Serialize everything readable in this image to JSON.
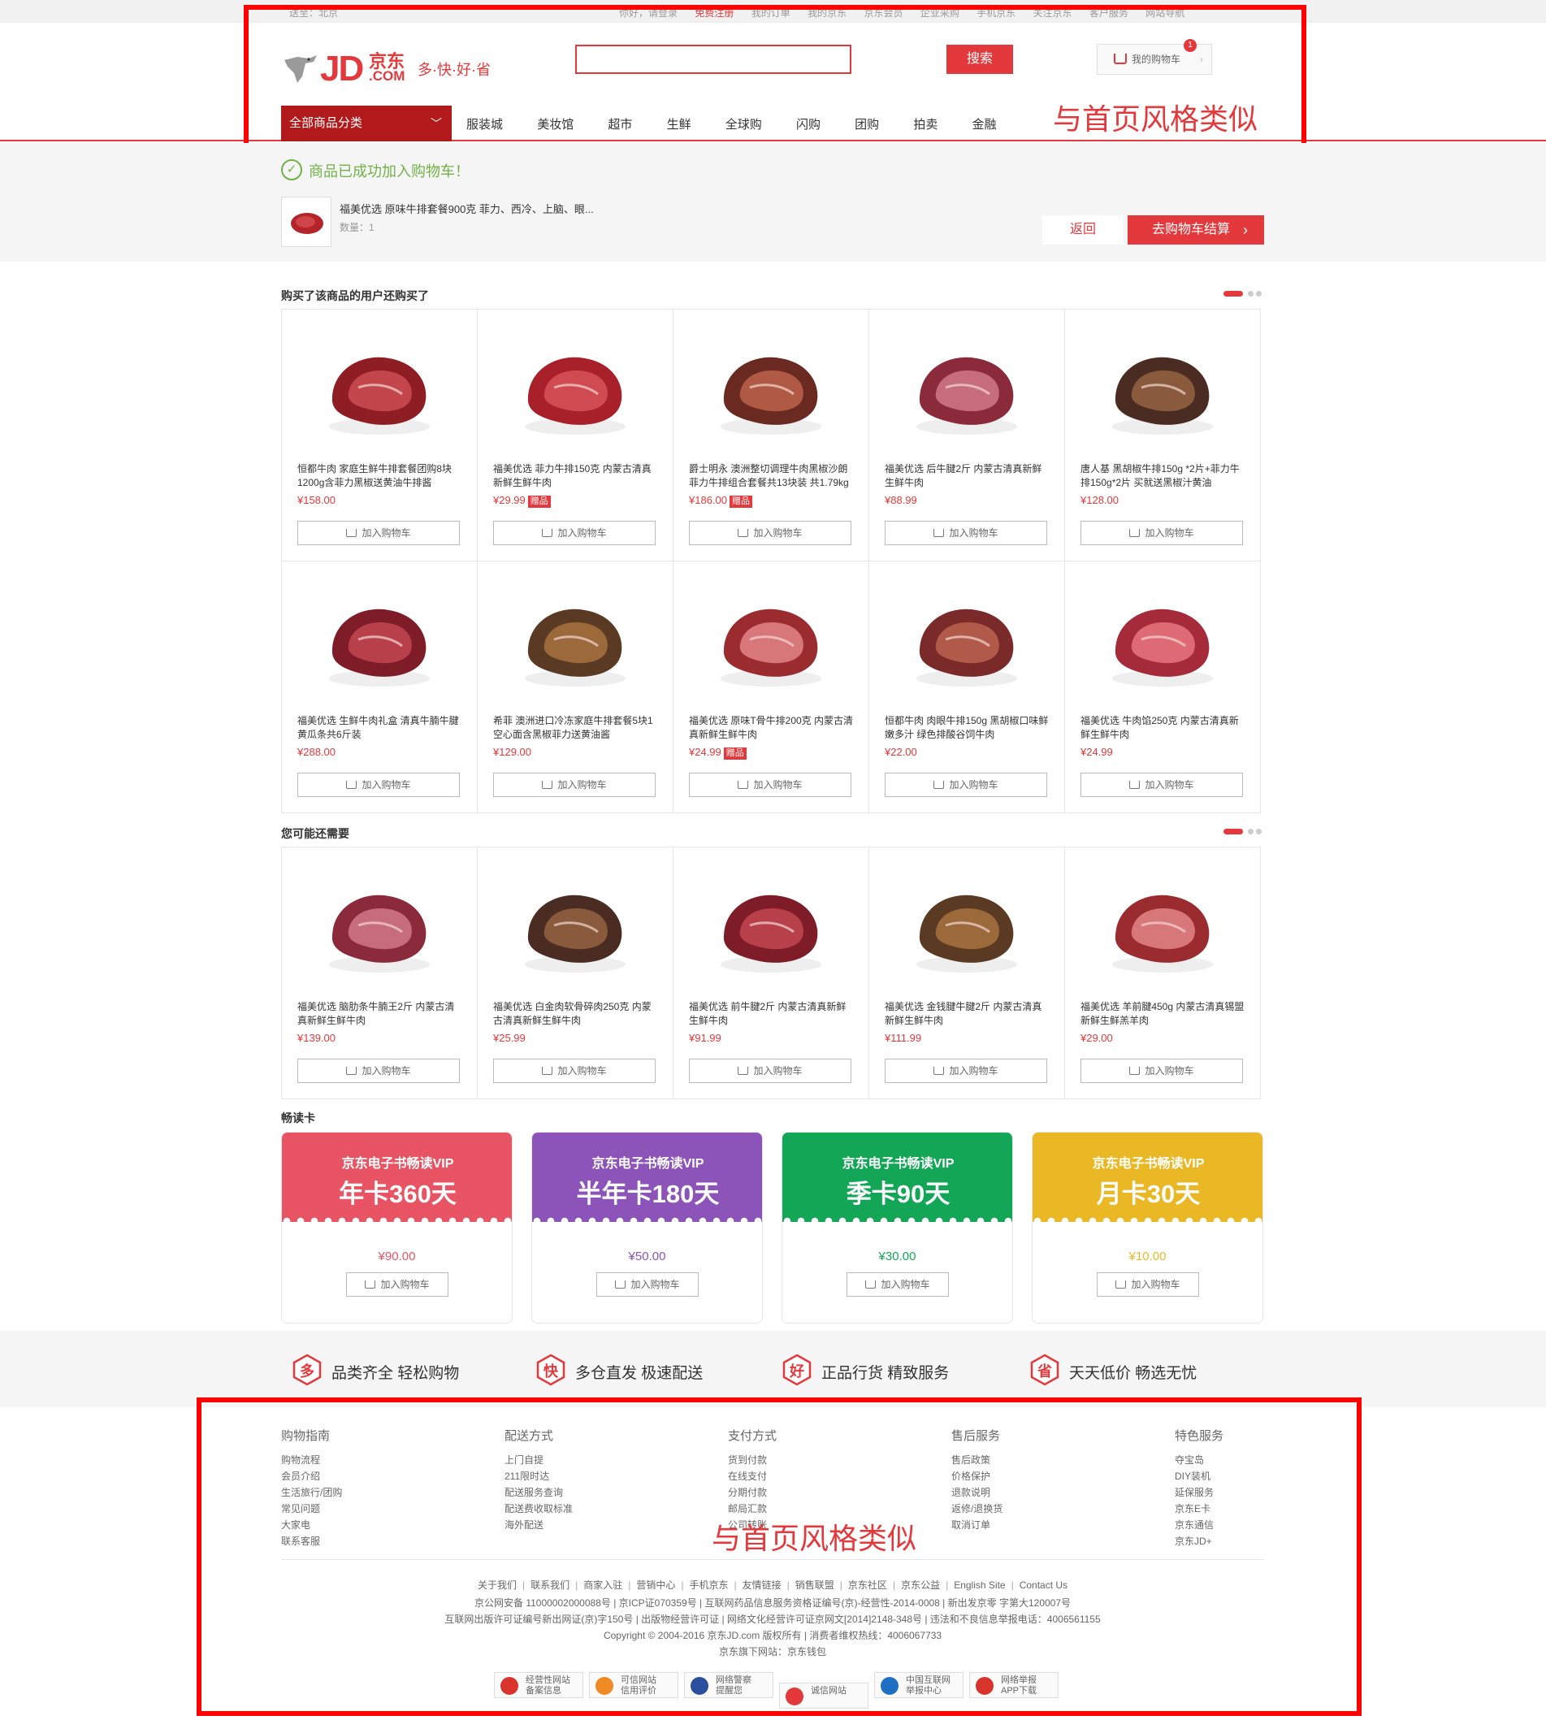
{
  "topbar": {
    "location_label": "送至：北京",
    "links": [
      "你好，请登录",
      "免费注册",
      "我的订单",
      "我的京东",
      "京东会员",
      "企业采购",
      "手机京东",
      "关注京东",
      "客户服务",
      "网站导航"
    ]
  },
  "header": {
    "logo_text": "JD",
    "logo_cn": "京东",
    "logo_com": ".COM",
    "slogan": "多·快·好·省",
    "search_placeholder": "",
    "search_button": "搜索",
    "cart_label": "我的购物车",
    "cart_count": "1",
    "nav_all": "全部商品分类",
    "nav_items": [
      "服装城",
      "美妆馆",
      "超市",
      "生鲜",
      "全球购",
      "闪购",
      "团购",
      "拍卖",
      "金融"
    ]
  },
  "annotations": {
    "header_note": "与首页风格类似",
    "footer_note": "与首页风格类似"
  },
  "success": {
    "message": "商品已成功加入购物车！",
    "product_name": "福美优选 原味牛排套餐900克 菲力、西冷、上脑、眼...",
    "quantity": "数量：1",
    "back_button": "返回",
    "checkout_button": "去购物车结算"
  },
  "sections": {
    "also_bought_title": "购买了该商品的用户还购买了",
    "maybe_need_title": "您可能还需要",
    "reading_title": "畅读卡",
    "add_to_cart": "加入购物车",
    "gift_label": "赠品"
  },
  "also_bought": [
    {
      "name": "恒都牛肉 家庭生鲜牛排套餐团购8块1200g含菲力黑椒送黄油牛排酱",
      "price": "¥158.00",
      "gift": false
    },
    {
      "name": "福美优选 菲力牛排150克 内蒙古清真新鲜生鲜牛肉",
      "price": "¥29.99",
      "gift": true
    },
    {
      "name": "爵士明永 澳洲整切调理牛肉黑椒沙朗菲力牛排组合套餐共13块装 共1.79kg",
      "price": "¥186.00",
      "gift": true
    },
    {
      "name": "福美优选 后牛腱2斤 内蒙古清真新鲜生鲜牛肉",
      "price": "¥88.99",
      "gift": false
    },
    {
      "name": "唐人基 黑胡椒牛排150g *2片+菲力牛排150g*2片 买就送黑椒汁黄油",
      "price": "¥128.00",
      "gift": false
    },
    {
      "name": "福美优选 生鲜牛肉礼盒 清真牛腩牛腱黄瓜条共6斤装",
      "price": "¥288.00",
      "gift": false
    },
    {
      "name": "希菲 澳洲进口冷冻家庭牛排套餐5块1空心面含黑椒菲力送黄油酱",
      "price": "¥129.00",
      "gift": false
    },
    {
      "name": "福美优选 原味T骨牛排200克 内蒙古清真新鲜生鲜牛肉",
      "price": "¥24.99",
      "gift": true
    },
    {
      "name": "恒都牛肉 肉眼牛排150g 黑胡椒口味鲜嫩多汁 绿色排酸谷饲牛肉",
      "price": "¥22.00",
      "gift": false
    },
    {
      "name": "福美优选 牛肉馅250克 内蒙古清真新鲜生鲜牛肉",
      "price": "¥24.99",
      "gift": false
    }
  ],
  "maybe_need": [
    {
      "name": "福美优选 脑肋条牛腩王2斤 内蒙古清真新鲜生鲜牛肉",
      "price": "¥139.00"
    },
    {
      "name": "福美优选 白金肉软骨碎肉250克 内蒙古清真新鲜生鲜牛肉",
      "price": "¥25.99"
    },
    {
      "name": "福美优选 前牛腱2斤 内蒙古清真新鲜生鲜牛肉",
      "price": "¥91.99"
    },
    {
      "name": "福美优选 金钱腱牛腱2斤 内蒙古清真新鲜生鲜牛肉",
      "price": "¥111.99"
    },
    {
      "name": "福美优选 羊前腱450g 内蒙古清真锡盟新鲜生鲜羔羊肉",
      "price": "¥29.00"
    }
  ],
  "reading_cards": [
    {
      "title": "京东电子书畅读VIP",
      "plan": "年卡360天",
      "price": "¥90.00",
      "color": "#e95464"
    },
    {
      "title": "京东电子书畅读VIP",
      "plan": "半年卡180天",
      "price": "¥50.00",
      "color": "#8c53b9"
    },
    {
      "title": "京东电子书畅读VIP",
      "plan": "季卡90天",
      "price": "¥30.00",
      "color": "#13a657"
    },
    {
      "title": "京东电子书畅读VIP",
      "plan": "月卡30天",
      "price": "¥10.00",
      "color": "#eab824"
    }
  ],
  "service": [
    {
      "glyph": "多",
      "text": "品类齐全  轻松购物"
    },
    {
      "glyph": "快",
      "text": "多仓直发  极速配送"
    },
    {
      "glyph": "好",
      "text": "正品行货  精致服务"
    },
    {
      "glyph": "省",
      "text": "天天低价  畅选无忧"
    }
  ],
  "footer": {
    "columns": [
      {
        "title": "购物指南",
        "links": [
          "购物流程",
          "会员介绍",
          "生活旅行/团购",
          "常见问题",
          "大家电",
          "联系客服"
        ]
      },
      {
        "title": "配送方式",
        "links": [
          "上门自提",
          "211限时达",
          "配送服务查询",
          "配送费收取标准",
          "海外配送"
        ]
      },
      {
        "title": "支付方式",
        "links": [
          "货到付款",
          "在线支付",
          "分期付款",
          "邮局汇款",
          "公司转账"
        ]
      },
      {
        "title": "售后服务",
        "links": [
          "售后政策",
          "价格保护",
          "退款说明",
          "返修/退换货",
          "取消订单"
        ]
      },
      {
        "title": "特色服务",
        "links": [
          "夺宝岛",
          "DIY装机",
          "延保服务",
          "京东E卡",
          "京东通信",
          "京东JD+"
        ]
      }
    ],
    "about_links": [
      "关于我们",
      "联系我们",
      "商家入驻",
      "营销中心",
      "手机京东",
      "友情链接",
      "销售联盟",
      "京东社区",
      "京东公益",
      "English Site",
      "Contact Us"
    ],
    "line1": "京公网安备 11000002000088号 | 京ICP证070359号 | 互联网药品信息服务资格证编号(京)-经营性-2014-0008 | 新出发京零 字第大120007号",
    "line2": "互联网出版许可证编号新出网证(京)字150号 | 出版物经营许可证 | 网络文化经营许可证京网文[2014]2148-348号 | 违法和不良信息举报电话：4006561155",
    "line3": "Copyright © 2004-2016  京东JD.com 版权所有 | 消费者维权热线：4006067733",
    "line4": "京东旗下网站：京东钱包",
    "badges": [
      {
        "text1": "经营性网站",
        "text2": "备案信息",
        "color": "#d9342b"
      },
      {
        "text1": "可信网站",
        "text2": "信用评价",
        "color": "#f08a24"
      },
      {
        "text1": "网络警察",
        "text2": "提醒您",
        "color": "#2a4f9c"
      },
      {
        "text1": "诚信网站",
        "text2": "",
        "color": "#e4393c"
      },
      {
        "text1": "中国互联网",
        "text2": "举报中心",
        "color": "#1f6fc4"
      },
      {
        "text1": "网络举报",
        "text2": "APP下载",
        "color": "#d9342b"
      }
    ]
  }
}
